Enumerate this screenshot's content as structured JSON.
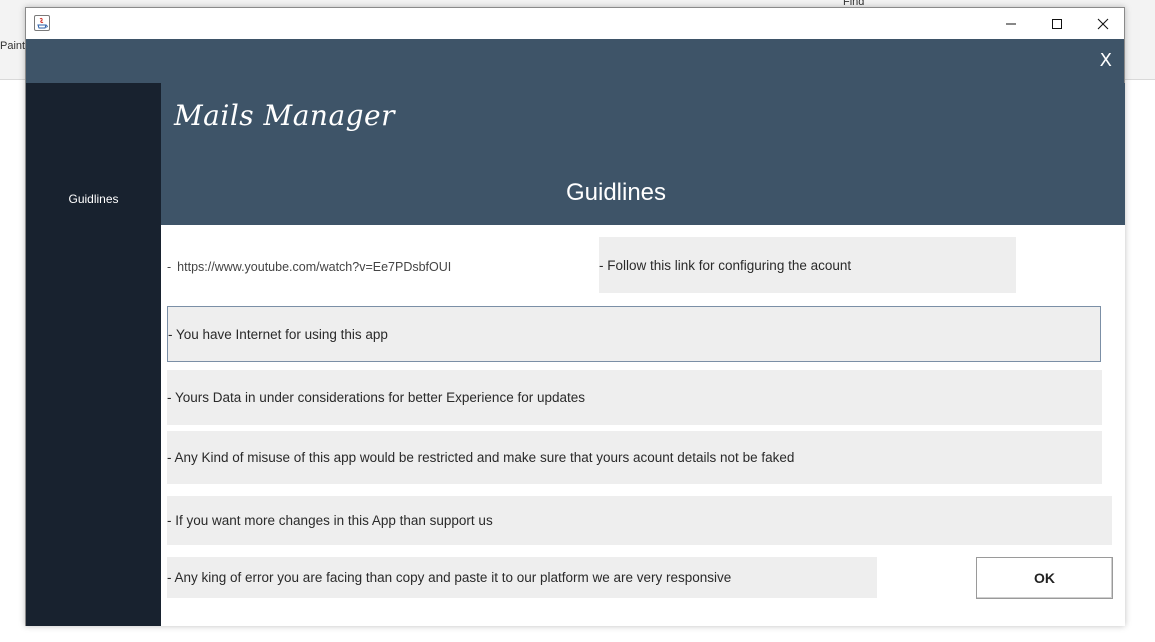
{
  "background_app": {
    "left_label": "Paint",
    "right_label": "Find"
  },
  "window": {
    "icon": "java-icon",
    "controls": {
      "minimize": "minimize-icon",
      "maximize": "maximize-icon",
      "close": "close-icon"
    }
  },
  "app": {
    "close_label": "X",
    "title": "Mails Manager",
    "section_title": "Guidlines",
    "sidebar": {
      "items": [
        {
          "label": "Guidlines"
        }
      ]
    },
    "link": {
      "caret": "-",
      "url": "https://www.youtube.com/watch?v=Ee7PDsbfOUI"
    },
    "follow_text": "- Follow this link for configuring the acount",
    "guidelines": [
      "-  You have Internet for using this app",
      "- Yours Data in under considerations for better Experience for updates",
      "- Any Kind of misuse of this app would be restricted and make sure that yours acount details not be faked",
      "- If you want more changes in this App than support us",
      "- Any king of error you are facing than copy and paste it to our platform we are very responsive"
    ],
    "ok_label": "OK"
  },
  "colors": {
    "header_bg": "#3e5468",
    "sidebar_bg": "#18222f",
    "row_bg": "#eeeeee",
    "focus_border": "#7b8fa6"
  }
}
